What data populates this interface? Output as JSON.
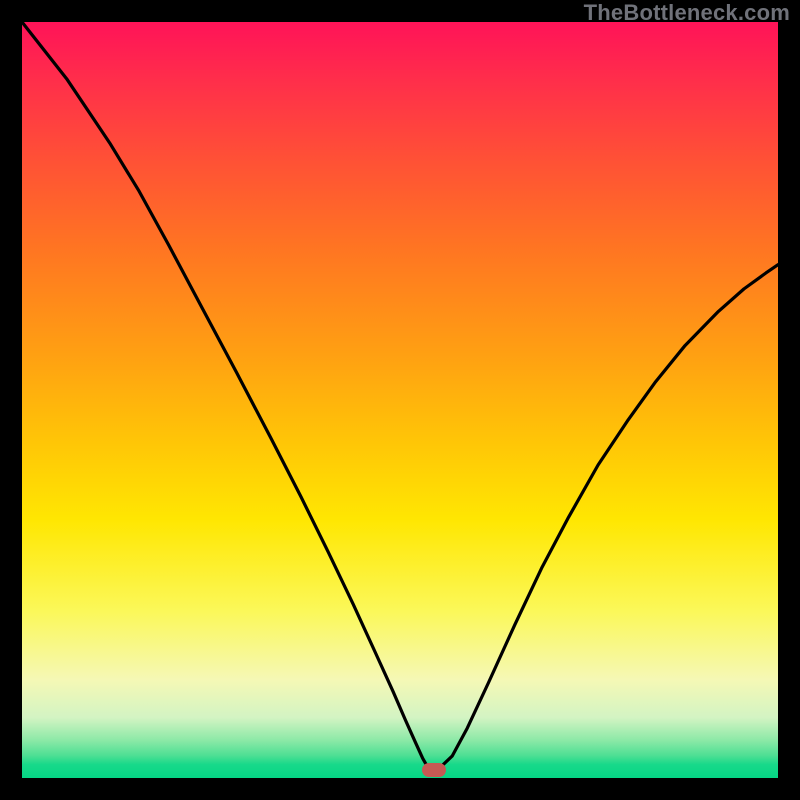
{
  "watermark": "TheBottleneck.com",
  "marker": {
    "x_pct": 54.5,
    "y_pct": 99.0,
    "color": "#c65a54"
  },
  "chart_data": {
    "type": "line",
    "title": "",
    "xlabel": "",
    "ylabel": "",
    "xlim": [
      0,
      100
    ],
    "ylim": [
      0,
      100
    ],
    "grid": false,
    "series": [
      {
        "name": "curve",
        "x": [
          0.0,
          5.9,
          11.6,
          15.5,
          19.4,
          23.6,
          28.4,
          32.9,
          36.9,
          40.5,
          43.8,
          46.6,
          49.1,
          50.7,
          52.0,
          53.0,
          53.8,
          55.1,
          56.9,
          58.9,
          61.7,
          65.2,
          68.8,
          72.3,
          76.2,
          80.2,
          83.8,
          87.7,
          92.1,
          95.5,
          98.4,
          100.0
        ],
        "y": [
          100.0,
          92.5,
          84.0,
          77.6,
          70.5,
          62.6,
          53.6,
          45.0,
          37.2,
          29.9,
          23.0,
          16.9,
          11.4,
          7.7,
          4.8,
          2.6,
          1.2,
          1.2,
          2.9,
          6.6,
          12.6,
          20.3,
          27.9,
          34.5,
          41.4,
          47.4,
          52.4,
          57.2,
          61.7,
          64.7,
          66.8,
          67.9
        ]
      }
    ],
    "marker_point": {
      "x": 54.5,
      "y": 1.0
    },
    "background_gradient": [
      {
        "pos": 0.0,
        "color": "#ff1358"
      },
      {
        "pos": 0.18,
        "color": "#ff5036"
      },
      {
        "pos": 0.44,
        "color": "#ffa012"
      },
      {
        "pos": 0.66,
        "color": "#ffe702"
      },
      {
        "pos": 0.87,
        "color": "#f5f8b5"
      },
      {
        "pos": 0.95,
        "color": "#8ce9a7"
      },
      {
        "pos": 1.0,
        "color": "#05d685"
      }
    ]
  }
}
